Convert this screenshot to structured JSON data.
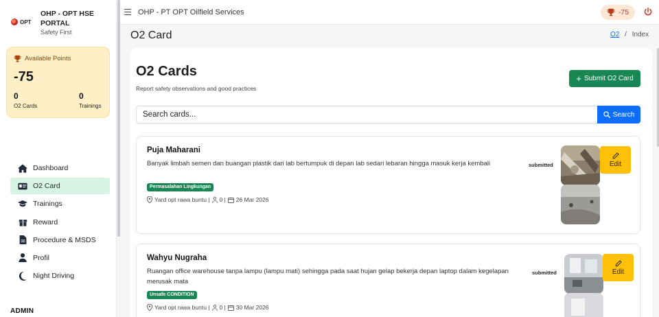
{
  "brand": {
    "logo_text": "OPT",
    "title": "OHP - OPT HSE PORTAL",
    "subtitle": "Safety First"
  },
  "points_card": {
    "label": "Available Points",
    "value": "-75",
    "o2_cards_count": "0",
    "o2_cards_label": "O2 Cards",
    "trainings_count": "0",
    "trainings_label": "Trainings"
  },
  "nav": [
    {
      "label": "Dashboard",
      "icon": "home-icon",
      "active": false
    },
    {
      "label": "O2 Card",
      "icon": "id-card-icon",
      "active": true
    },
    {
      "label": "Trainings",
      "icon": "graduation-cap-icon",
      "active": false
    },
    {
      "label": "Reward",
      "icon": "gift-icon",
      "active": false
    },
    {
      "label": "Procedure & MSDS",
      "icon": "document-icon",
      "active": false
    },
    {
      "label": "Profil",
      "icon": "user-icon",
      "active": false
    },
    {
      "label": "Night Driving",
      "icon": "moon-icon",
      "active": false
    }
  ],
  "admin_heading": "ADMIN",
  "topbar": {
    "title": "OHP - PT OPT Oilfield Services",
    "points": "-75"
  },
  "page": {
    "title": "O2 Card",
    "breadcrumb": {
      "link": "O2",
      "separator": "/",
      "current": "Index"
    }
  },
  "main": {
    "heading": "O2 Cards",
    "subheading": "Report safety observations and good practices",
    "submit_label": "Submit O2 Card",
    "search_placeholder": "Search cards...",
    "search_label": "Search"
  },
  "cards": [
    {
      "name": "Puja Maharani",
      "description": "Banyak limbah semen dan buangan plastik dari lab bertumpuk di depan lab sedari lebaran hingga masuk kerja kembali",
      "tag": "Permasalahan Lingkungan",
      "location": "Yard opt rawa buntu |",
      "likes": "0 |",
      "date": "26 Mar 2026",
      "status": "submitted",
      "edit_label": "Edit"
    },
    {
      "name": "Wahyu Nugraha",
      "description": "Ruangan office warehouse tanpa lampu (lampu mati) sehingga pada saat hujan gelap bekerja depan laptop dalam kegelapan merusak mata",
      "tag": "Unsafe CONDITION",
      "location": "Yard opt rawa buntu |",
      "likes": "0 |",
      "date": "30 Mar 2026",
      "status": "submitted",
      "edit_label": "Edit"
    }
  ],
  "colors": {
    "primary": "#0d6efd",
    "success": "#198754",
    "warning": "#ffc107",
    "points_bg": "#fdefc6",
    "active_nav": "#d7f5e4",
    "danger": "#c0392b"
  }
}
